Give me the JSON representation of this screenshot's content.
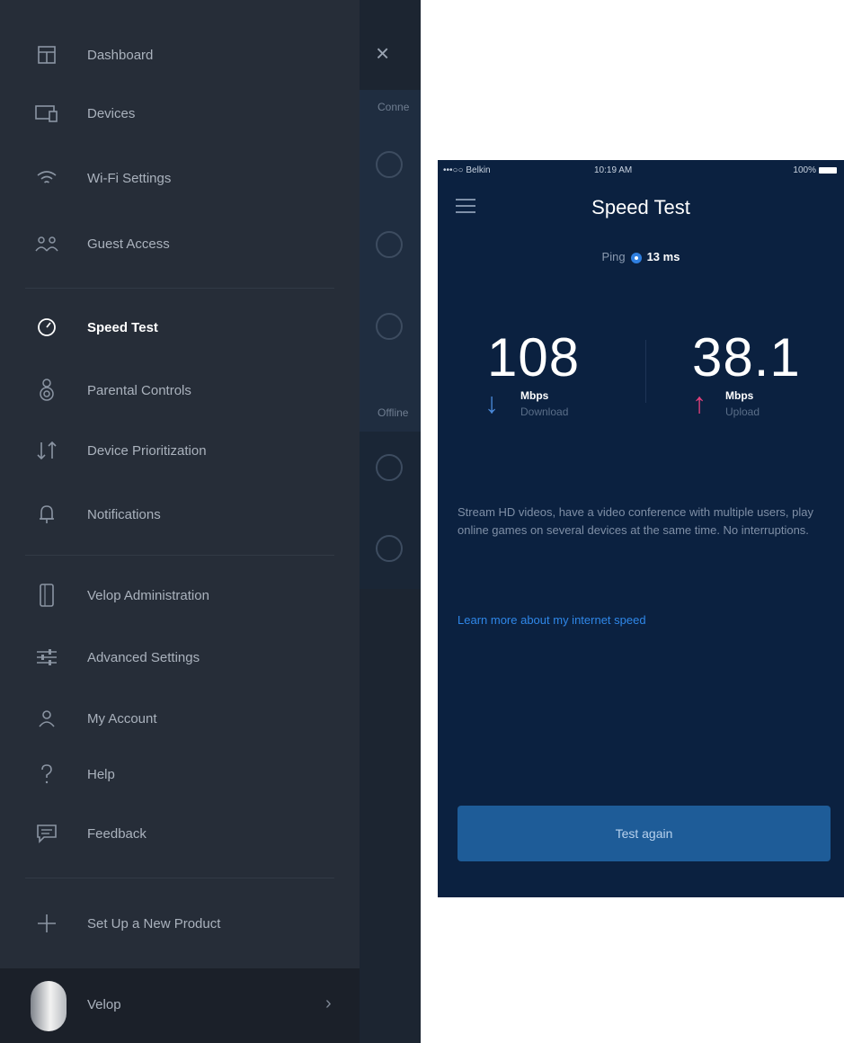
{
  "drawer": {
    "items": [
      {
        "label": "Dashboard",
        "icon": "dashboard-icon"
      },
      {
        "label": "Devices",
        "icon": "devices-icon"
      },
      {
        "label": "Wi-Fi Settings",
        "icon": "wifi-icon"
      },
      {
        "label": "Guest Access",
        "icon": "guest-access-icon"
      },
      {
        "label": "Speed Test",
        "icon": "speedometer-icon",
        "active": true
      },
      {
        "label": "Parental Controls",
        "icon": "parental-controls-icon"
      },
      {
        "label": "Device Prioritization",
        "icon": "prioritization-arrows-icon"
      },
      {
        "label": "Notifications",
        "icon": "bell-icon"
      },
      {
        "label": "Velop Administration",
        "icon": "velop-node-icon"
      },
      {
        "label": "Advanced Settings",
        "icon": "sliders-icon"
      },
      {
        "label": "My Account",
        "icon": "user-icon"
      },
      {
        "label": "Help",
        "icon": "question-icon"
      },
      {
        "label": "Feedback",
        "icon": "feedback-icon"
      },
      {
        "label": "Set Up a New Product",
        "icon": "plus-icon"
      }
    ],
    "footer": {
      "label": "Velop"
    }
  },
  "background_panel": {
    "close_icon": "×",
    "section_connected": "Conne",
    "section_offline": "Offline"
  },
  "status_bar": {
    "carrier": "•••○○ Belkin",
    "time": "10:19 AM",
    "battery": "100%"
  },
  "speed_test": {
    "title": "Speed Test",
    "ping_label": "Ping",
    "ping_value": "13 ms",
    "download_value": "108",
    "download_unit": "Mbps",
    "download_label": "Download",
    "upload_value": "38.1",
    "upload_unit": "Mbps",
    "upload_label": "Upload",
    "description": "Stream HD videos, have a video conference with multiple users, play online games on several devices at the same time. No interruptions.",
    "learn_more": "Learn more about my internet speed",
    "test_again": "Test again"
  },
  "colors": {
    "drawer_bg": "#262d38",
    "speed_bg": "#0b2140",
    "accent_blue": "#2f87e8",
    "download_arrow": "#4a88d8",
    "upload_arrow": "#e0407a",
    "button_bg": "#1e5c98"
  }
}
